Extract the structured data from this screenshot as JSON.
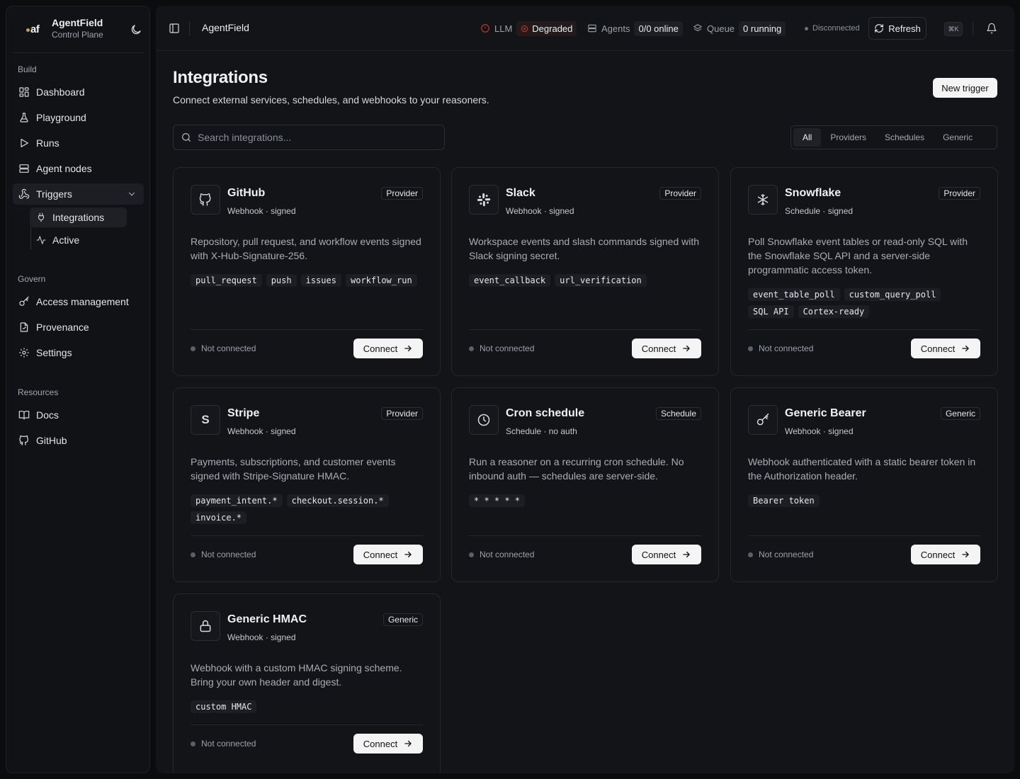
{
  "brand": {
    "logo": "af",
    "title": "AgentField",
    "subtitle": "Control Plane"
  },
  "sidebar": {
    "sections": [
      {
        "label": "Build"
      },
      {
        "label": "Govern"
      },
      {
        "label": "Resources"
      }
    ],
    "items": {
      "dashboard": "Dashboard",
      "playground": "Playground",
      "runs": "Runs",
      "agent_nodes": "Agent nodes",
      "triggers": "Triggers",
      "integrations": "Integrations",
      "active": "Active",
      "access": "Access management",
      "provenance": "Provenance",
      "settings": "Settings",
      "docs": "Docs",
      "github": "GitHub"
    }
  },
  "topbar": {
    "title": "AgentField",
    "llm_label": "LLM",
    "llm_status": "Degraded",
    "agents_label": "Agents",
    "agents_value": "0/0 online",
    "queue_label": "Queue",
    "queue_value": "0 running",
    "connection": "Disconnected",
    "refresh_label": "Refresh",
    "shortcut": "⌘K"
  },
  "page": {
    "title": "Integrations",
    "subtitle": "Connect external services, schedules, and webhooks to your reasoners.",
    "new_trigger": "New trigger",
    "search_placeholder": "Search integrations...",
    "filters": [
      "All",
      "Providers",
      "Schedules",
      "Generic"
    ]
  },
  "cards": [
    {
      "name": "GitHub",
      "meta": "Webhook · signed",
      "tag": "Provider",
      "desc": "Repository, pull request, and workflow events signed with X-Hub-Signature-256.",
      "chips": [
        "pull_request",
        "push",
        "issues",
        "workflow_run"
      ],
      "status": "Not connected",
      "action": "Connect",
      "icon": "github-icon"
    },
    {
      "name": "Slack",
      "meta": "Webhook · signed",
      "tag": "Provider",
      "desc": "Workspace events and slash commands signed with Slack signing secret.",
      "chips": [
        "event_callback",
        "url_verification"
      ],
      "status": "Not connected",
      "action": "Connect",
      "icon": "slack-icon"
    },
    {
      "name": "Snowflake",
      "meta": "Schedule · signed",
      "tag": "Provider",
      "desc": "Poll Snowflake event tables or read-only SQL with the Snowflake SQL API and a server-side programmatic access token.",
      "chips": [
        "event_table_poll",
        "custom_query_poll",
        "SQL API",
        "Cortex-ready"
      ],
      "status": "Not connected",
      "action": "Connect",
      "icon": "snowflake-icon"
    },
    {
      "name": "Stripe",
      "meta": "Webhook · signed",
      "tag": "Provider",
      "desc": "Payments, subscriptions, and customer events signed with Stripe-Signature HMAC.",
      "chips": [
        "payment_intent.*",
        "checkout.session.*",
        "invoice.*"
      ],
      "status": "Not connected",
      "action": "Connect",
      "icon": "stripe-icon"
    },
    {
      "name": "Cron schedule",
      "meta": "Schedule · no auth",
      "tag": "Schedule",
      "desc": "Run a reasoner on a recurring cron schedule. No inbound auth — schedules are server-side.",
      "chips": [
        "* * * * *"
      ],
      "status": "Not connected",
      "action": "Connect",
      "icon": "clock-icon"
    },
    {
      "name": "Generic Bearer",
      "meta": "Webhook · signed",
      "tag": "Generic",
      "desc": "Webhook authenticated with a static bearer token in the Authorization header.",
      "chips": [
        "Bearer token"
      ],
      "status": "Not connected",
      "action": "Connect",
      "icon": "key-icon"
    },
    {
      "name": "Generic HMAC",
      "meta": "Webhook · signed",
      "tag": "Generic",
      "desc": "Webhook with a custom HMAC signing scheme. Bring your own header and digest.",
      "chips": [
        "custom HMAC"
      ],
      "status": "Not connected",
      "action": "Connect",
      "icon": "lock-icon"
    }
  ],
  "colors": {
    "background": "#0b0c0e",
    "panel": "#131418",
    "degraded": "#c0392b",
    "button": "#f4f4f5"
  }
}
